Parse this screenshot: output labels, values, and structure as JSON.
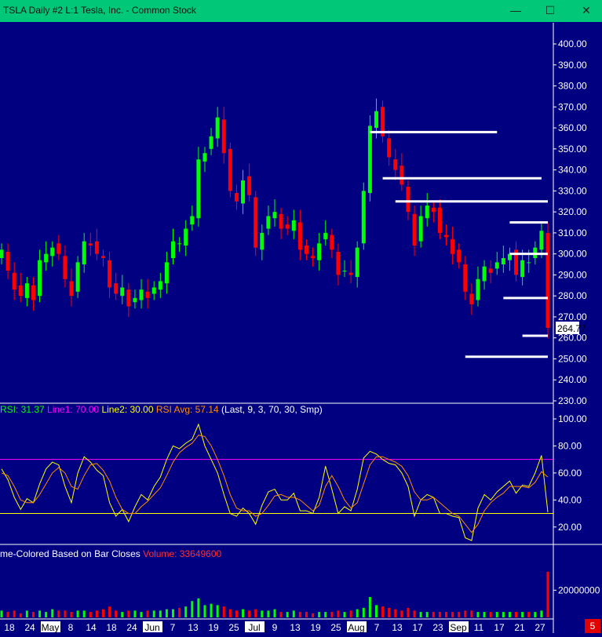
{
  "window": {
    "title": "TSLA  Daily  #2  L:1  Tesla, Inc.  - Common Stock",
    "minimize_icon": "minus-icon",
    "maximize_icon": "square-icon",
    "close_icon": "x-icon"
  },
  "colors": {
    "background": "#000080",
    "up": "#00ff00",
    "down": "#ff0000",
    "line1": "#ff00ff",
    "line2": "#ffff00",
    "rsi": "#ffff00",
    "rsi_avg": "#ff8c00",
    "marker": "#ffffff"
  },
  "rsi_legend": {
    "rsi": "RSI: 31.37",
    "line1": "Line1: 70.00",
    "line2": "Line2: 30.00",
    "avg": "RSI Avg: 57.14",
    "params": "(Last, 9, 3, 70, 30, Smp)"
  },
  "volume_legend": {
    "label": "me-Colored Based on Bar Closes",
    "value": "Volume: 33649600"
  },
  "last_price": "264.77",
  "bottom_box": "5",
  "chart_data": [
    {
      "type": "candlestick",
      "title": "TSLA Daily",
      "ylim": [
        230,
        400
      ],
      "yticks": [
        "400.00",
        "390.00",
        "380.00",
        "370.00",
        "360.00",
        "350.00",
        "340.00",
        "330.00",
        "320.00",
        "310.00",
        "300.00",
        "290.00",
        "280.00",
        "270.00",
        "260.00",
        "250.00",
        "240.00",
        "230.00"
      ],
      "closes": [
        302,
        292,
        283,
        280,
        286,
        278,
        297,
        300,
        303,
        300,
        288,
        280,
        296,
        306,
        304,
        300,
        298,
        284,
        281,
        284,
        275,
        279,
        283,
        279,
        284,
        287,
        296,
        306,
        305,
        312,
        318,
        345,
        348,
        356,
        365,
        348,
        330,
        325,
        335,
        328,
        303,
        310,
        318,
        320,
        312,
        312,
        316,
        302,
        300,
        298,
        305,
        310,
        302,
        290,
        292,
        290,
        303,
        330,
        361,
        368,
        356,
        346,
        340,
        333,
        320,
        304,
        318,
        323,
        320,
        310,
        308,
        300,
        296,
        282,
        276,
        288,
        294,
        291,
        296,
        298,
        300,
        290,
        297,
        296,
        303,
        311,
        264.77
      ],
      "line_levels": [
        {
          "label": "marker-1",
          "value": 358
        },
        {
          "label": "marker-2",
          "value": 336
        },
        {
          "label": "marker-3",
          "value": 325
        },
        {
          "label": "marker-4",
          "value": 315
        },
        {
          "label": "marker-5",
          "value": 300
        },
        {
          "label": "marker-6",
          "value": 279
        },
        {
          "label": "marker-7",
          "value": 261
        },
        {
          "label": "marker-8",
          "value": 251
        }
      ],
      "x_tick_labels": [
        "18",
        "24",
        "May",
        "8",
        "14",
        "18",
        "24",
        "Jun",
        "7",
        "13",
        "19",
        "25",
        "Jul",
        "9",
        "13",
        "19",
        "25",
        "Aug",
        "7",
        "13",
        "17",
        "23",
        "Sep",
        "11",
        "17",
        "21",
        "27"
      ]
    },
    {
      "type": "line",
      "title": "RSI",
      "ylim": [
        10,
        100
      ],
      "yticks": [
        "100.00",
        "80.00",
        "60.00",
        "40.00",
        "20.00"
      ],
      "line1": 70,
      "line2": 30,
      "series": [
        {
          "name": "RSI",
          "values": [
            63,
            55,
            42,
            33,
            41,
            38,
            52,
            63,
            68,
            66,
            50,
            38,
            60,
            72,
            68,
            62,
            58,
            38,
            28,
            33,
            24,
            35,
            44,
            40,
            50,
            57,
            70,
            80,
            78,
            82,
            85,
            96,
            80,
            70,
            60,
            44,
            30,
            28,
            34,
            30,
            22,
            36,
            46,
            48,
            40,
            40,
            45,
            32,
            32,
            30,
            42,
            65,
            48,
            30,
            35,
            32,
            48,
            71,
            76,
            74,
            70,
            67,
            66,
            60,
            50,
            28,
            40,
            44,
            42,
            30,
            30,
            28,
            27,
            12,
            10,
            34,
            44,
            40,
            46,
            50,
            54,
            45,
            51,
            50,
            60,
            73,
            31
          ]
        },
        {
          "name": "RSI Avg",
          "values": [
            60,
            58,
            50,
            40,
            38,
            38,
            44,
            52,
            60,
            64,
            60,
            50,
            48,
            58,
            66,
            67,
            62,
            54,
            42,
            33,
            30,
            30,
            35,
            39,
            44,
            49,
            58,
            68,
            75,
            79,
            82,
            88,
            87,
            80,
            70,
            58,
            44,
            34,
            32,
            32,
            28,
            30,
            36,
            43,
            44,
            42,
            42,
            40,
            36,
            32,
            36,
            50,
            58,
            50,
            40,
            34,
            38,
            52,
            66,
            72,
            72,
            70,
            68,
            65,
            58,
            46,
            40,
            40,
            42,
            38,
            34,
            30,
            28,
            22,
            16,
            22,
            32,
            38,
            42,
            45,
            50,
            50,
            50,
            49,
            53,
            61,
            57
          ]
        }
      ]
    },
    {
      "type": "bar",
      "title": "Volume",
      "ylim": [
        0,
        45000000
      ],
      "yticks": [
        "20000000"
      ],
      "values": [
        5,
        4,
        5,
        3,
        5,
        4,
        5,
        4,
        6,
        5,
        5,
        4,
        5,
        5,
        4,
        5,
        6,
        8,
        5,
        4,
        5,
        5,
        4,
        5,
        5,
        5,
        6,
        6,
        7,
        8,
        12,
        14,
        9,
        10,
        9,
        8,
        6,
        5,
        6,
        5,
        6,
        5,
        5,
        6,
        4,
        4,
        5,
        4,
        4,
        3,
        4,
        4,
        4,
        5,
        4,
        5,
        6,
        7,
        15,
        9,
        8,
        7,
        6,
        5,
        7,
        5,
        4,
        4,
        4,
        4,
        4,
        4,
        4,
        5,
        5,
        4,
        4,
        4,
        4,
        4,
        4,
        4,
        4,
        4,
        4,
        5,
        33.6
      ]
    }
  ]
}
